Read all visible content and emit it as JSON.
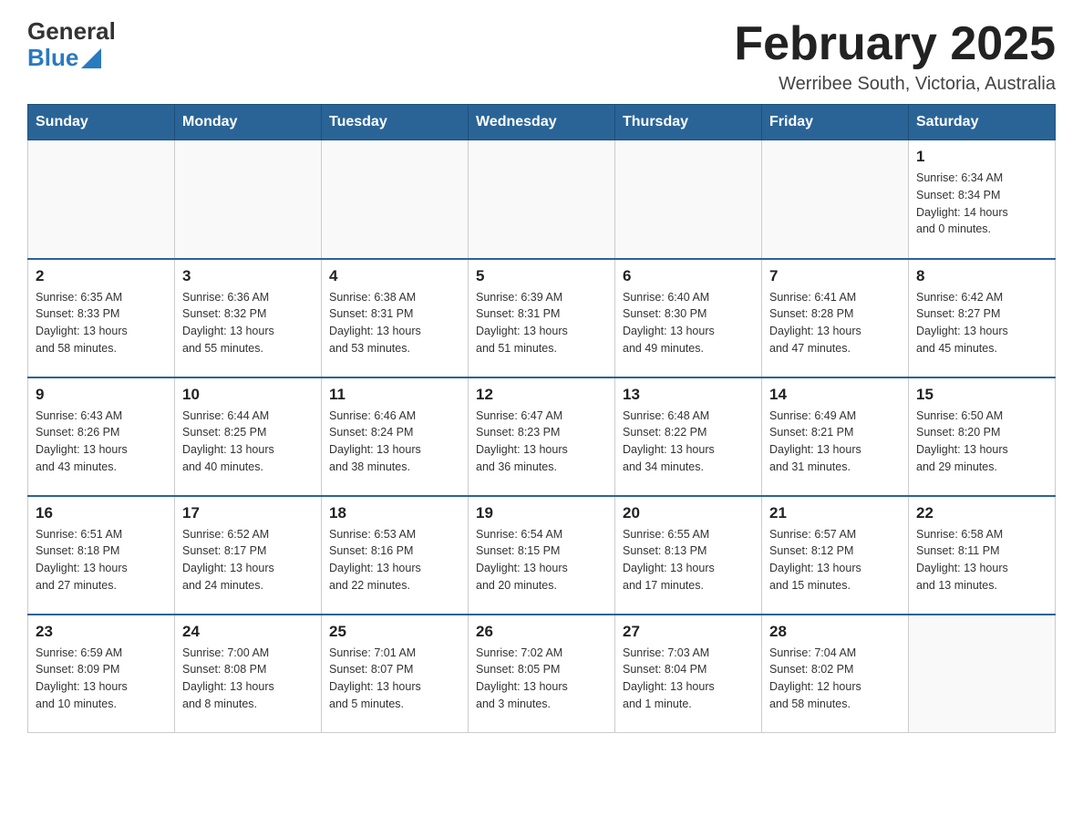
{
  "header": {
    "logo_general": "General",
    "logo_blue": "Blue",
    "month_title": "February 2025",
    "subtitle": "Werribee South, Victoria, Australia"
  },
  "days_of_week": [
    "Sunday",
    "Monday",
    "Tuesday",
    "Wednesday",
    "Thursday",
    "Friday",
    "Saturday"
  ],
  "weeks": [
    [
      {
        "day": "",
        "info": ""
      },
      {
        "day": "",
        "info": ""
      },
      {
        "day": "",
        "info": ""
      },
      {
        "day": "",
        "info": ""
      },
      {
        "day": "",
        "info": ""
      },
      {
        "day": "",
        "info": ""
      },
      {
        "day": "1",
        "info": "Sunrise: 6:34 AM\nSunset: 8:34 PM\nDaylight: 14 hours\nand 0 minutes."
      }
    ],
    [
      {
        "day": "2",
        "info": "Sunrise: 6:35 AM\nSunset: 8:33 PM\nDaylight: 13 hours\nand 58 minutes."
      },
      {
        "day": "3",
        "info": "Sunrise: 6:36 AM\nSunset: 8:32 PM\nDaylight: 13 hours\nand 55 minutes."
      },
      {
        "day": "4",
        "info": "Sunrise: 6:38 AM\nSunset: 8:31 PM\nDaylight: 13 hours\nand 53 minutes."
      },
      {
        "day": "5",
        "info": "Sunrise: 6:39 AM\nSunset: 8:31 PM\nDaylight: 13 hours\nand 51 minutes."
      },
      {
        "day": "6",
        "info": "Sunrise: 6:40 AM\nSunset: 8:30 PM\nDaylight: 13 hours\nand 49 minutes."
      },
      {
        "day": "7",
        "info": "Sunrise: 6:41 AM\nSunset: 8:28 PM\nDaylight: 13 hours\nand 47 minutes."
      },
      {
        "day": "8",
        "info": "Sunrise: 6:42 AM\nSunset: 8:27 PM\nDaylight: 13 hours\nand 45 minutes."
      }
    ],
    [
      {
        "day": "9",
        "info": "Sunrise: 6:43 AM\nSunset: 8:26 PM\nDaylight: 13 hours\nand 43 minutes."
      },
      {
        "day": "10",
        "info": "Sunrise: 6:44 AM\nSunset: 8:25 PM\nDaylight: 13 hours\nand 40 minutes."
      },
      {
        "day": "11",
        "info": "Sunrise: 6:46 AM\nSunset: 8:24 PM\nDaylight: 13 hours\nand 38 minutes."
      },
      {
        "day": "12",
        "info": "Sunrise: 6:47 AM\nSunset: 8:23 PM\nDaylight: 13 hours\nand 36 minutes."
      },
      {
        "day": "13",
        "info": "Sunrise: 6:48 AM\nSunset: 8:22 PM\nDaylight: 13 hours\nand 34 minutes."
      },
      {
        "day": "14",
        "info": "Sunrise: 6:49 AM\nSunset: 8:21 PM\nDaylight: 13 hours\nand 31 minutes."
      },
      {
        "day": "15",
        "info": "Sunrise: 6:50 AM\nSunset: 8:20 PM\nDaylight: 13 hours\nand 29 minutes."
      }
    ],
    [
      {
        "day": "16",
        "info": "Sunrise: 6:51 AM\nSunset: 8:18 PM\nDaylight: 13 hours\nand 27 minutes."
      },
      {
        "day": "17",
        "info": "Sunrise: 6:52 AM\nSunset: 8:17 PM\nDaylight: 13 hours\nand 24 minutes."
      },
      {
        "day": "18",
        "info": "Sunrise: 6:53 AM\nSunset: 8:16 PM\nDaylight: 13 hours\nand 22 minutes."
      },
      {
        "day": "19",
        "info": "Sunrise: 6:54 AM\nSunset: 8:15 PM\nDaylight: 13 hours\nand 20 minutes."
      },
      {
        "day": "20",
        "info": "Sunrise: 6:55 AM\nSunset: 8:13 PM\nDaylight: 13 hours\nand 17 minutes."
      },
      {
        "day": "21",
        "info": "Sunrise: 6:57 AM\nSunset: 8:12 PM\nDaylight: 13 hours\nand 15 minutes."
      },
      {
        "day": "22",
        "info": "Sunrise: 6:58 AM\nSunset: 8:11 PM\nDaylight: 13 hours\nand 13 minutes."
      }
    ],
    [
      {
        "day": "23",
        "info": "Sunrise: 6:59 AM\nSunset: 8:09 PM\nDaylight: 13 hours\nand 10 minutes."
      },
      {
        "day": "24",
        "info": "Sunrise: 7:00 AM\nSunset: 8:08 PM\nDaylight: 13 hours\nand 8 minutes."
      },
      {
        "day": "25",
        "info": "Sunrise: 7:01 AM\nSunset: 8:07 PM\nDaylight: 13 hours\nand 5 minutes."
      },
      {
        "day": "26",
        "info": "Sunrise: 7:02 AM\nSunset: 8:05 PM\nDaylight: 13 hours\nand 3 minutes."
      },
      {
        "day": "27",
        "info": "Sunrise: 7:03 AM\nSunset: 8:04 PM\nDaylight: 13 hours\nand 1 minute."
      },
      {
        "day": "28",
        "info": "Sunrise: 7:04 AM\nSunset: 8:02 PM\nDaylight: 12 hours\nand 58 minutes."
      },
      {
        "day": "",
        "info": ""
      }
    ]
  ]
}
